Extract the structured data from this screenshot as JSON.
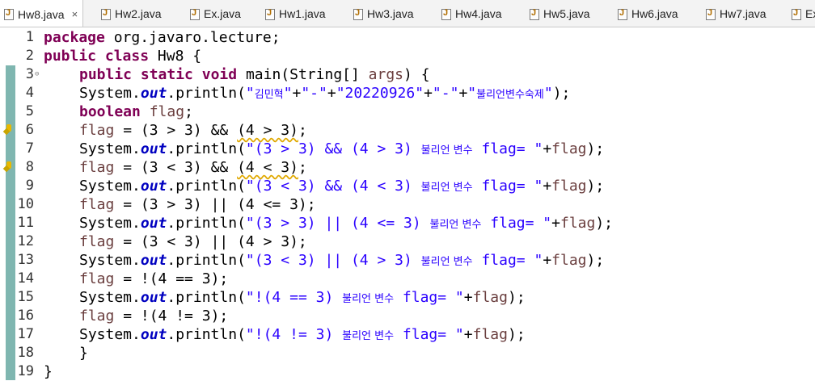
{
  "tabs": [
    {
      "label": "Hw8.java",
      "close": "×",
      "active": true
    },
    {
      "label": "Hw2.java"
    },
    {
      "label": "Ex.java"
    },
    {
      "label": "Hw1.java"
    },
    {
      "label": "Hw3.java"
    },
    {
      "label": "Hw4.java"
    },
    {
      "label": "Hw5.java"
    },
    {
      "label": "Hw6.java"
    },
    {
      "label": "Hw7.java"
    },
    {
      "label": "Ex"
    }
  ],
  "gutter": {
    "line_numbers": [
      "1",
      "2",
      "3",
      "4",
      "5",
      "6",
      "7",
      "8",
      "9",
      "10",
      "11",
      "12",
      "13",
      "14",
      "15",
      "16",
      "17",
      "18",
      "19"
    ],
    "fold_marker": "⊖"
  },
  "code": {
    "l1": {
      "kw": "package",
      "rest": " org.javaro.lecture;"
    },
    "l2": {
      "kw1": "public",
      "kw2": "class",
      "rest": " Hw8 {"
    },
    "l3": {
      "kw1": "public",
      "kw2": "static",
      "kw3": "void",
      "rest": " main(String[] ",
      "args": "args",
      "end": ") {"
    },
    "l4": {
      "pre": "System.",
      "out": "out",
      "mid": ".println(",
      "s1": "\"",
      "s1ko": "김민혁",
      "s1e": "\"",
      "p1": "+",
      "s2": "\"-\"",
      "p2": "+",
      "s3": "\"20220926\"",
      "p3": "+",
      "s4": "\"-\"",
      "p4": "+",
      "s5": "\"",
      "s5ko": "불리언변수숙제",
      "s5e": "\"",
      "end": ");"
    },
    "l5": {
      "kw": "boolean",
      "var": "flag",
      "end": ";"
    },
    "l6": {
      "var": "flag",
      "a": " = (3 > 3) && ",
      "b": "(4 > 3)",
      "end": ";"
    },
    "l7": {
      "pre": "System.",
      "out": "out",
      "mid": ".println(",
      "s": "\"(3 > 3) && (4 > 3) ",
      "ko": "불리언 변수",
      "s2": " flag= \"",
      "plus": "+",
      "var": "flag",
      "end": ");"
    },
    "l8": {
      "var": "flag",
      "a": " = (3 < 3) && ",
      "b": "(4 < 3)",
      "end": ";"
    },
    "l9": {
      "pre": "System.",
      "out": "out",
      "mid": ".println(",
      "s": "\"(3 < 3) && (4 < 3) ",
      "ko": "불리언 변수",
      "s2": " flag= \"",
      "plus": "+",
      "var": "flag",
      "end": ");"
    },
    "l10": {
      "var": "flag",
      "a": " = (3 > 3) || (4 <= 3);"
    },
    "l11": {
      "pre": "System.",
      "out": "out",
      "mid": ".println(",
      "s": "\"(3 > 3) || (4 <= 3) ",
      "ko": "불리언 변수",
      "s2": " flag= \"",
      "plus": "+",
      "var": "flag",
      "end": ");"
    },
    "l12": {
      "var": "flag",
      "a": " = (3 < 3) || (4 > 3);"
    },
    "l13": {
      "pre": "System.",
      "out": "out",
      "mid": ".println(",
      "s": "\"(3 < 3) || (4 > 3) ",
      "ko": "불리언 변수",
      "s2": " flag= \"",
      "plus": "+",
      "var": "flag",
      "end": ");"
    },
    "l14": {
      "var": "flag",
      "a": " = !(4 == 3);"
    },
    "l15": {
      "pre": "System.",
      "out": "out",
      "mid": ".println(",
      "s": "\"!(4 == 3) ",
      "ko": "불리언 변수",
      "s2": " flag= \"",
      "plus": "+",
      "var": "flag",
      "end": ");"
    },
    "l16": {
      "var": "flag",
      "a": " = !(4 != 3);"
    },
    "l17": {
      "pre": "System.",
      "out": "out",
      "mid": ".println(",
      "s": "\"!(4 != 3) ",
      "ko": "불리언 변수",
      "s2": " flag= \"",
      "plus": "+",
      "var": "flag",
      "end": ");"
    },
    "l18": {
      "a": "}"
    },
    "l19": {
      "a": "}"
    }
  },
  "colors": {
    "keyword": "#7f0055",
    "string": "#2a00ff",
    "field": "#0000c0",
    "variable": "#6a3e3e",
    "quick_diff": "#7fb6b0",
    "warning": "#e9b800"
  }
}
